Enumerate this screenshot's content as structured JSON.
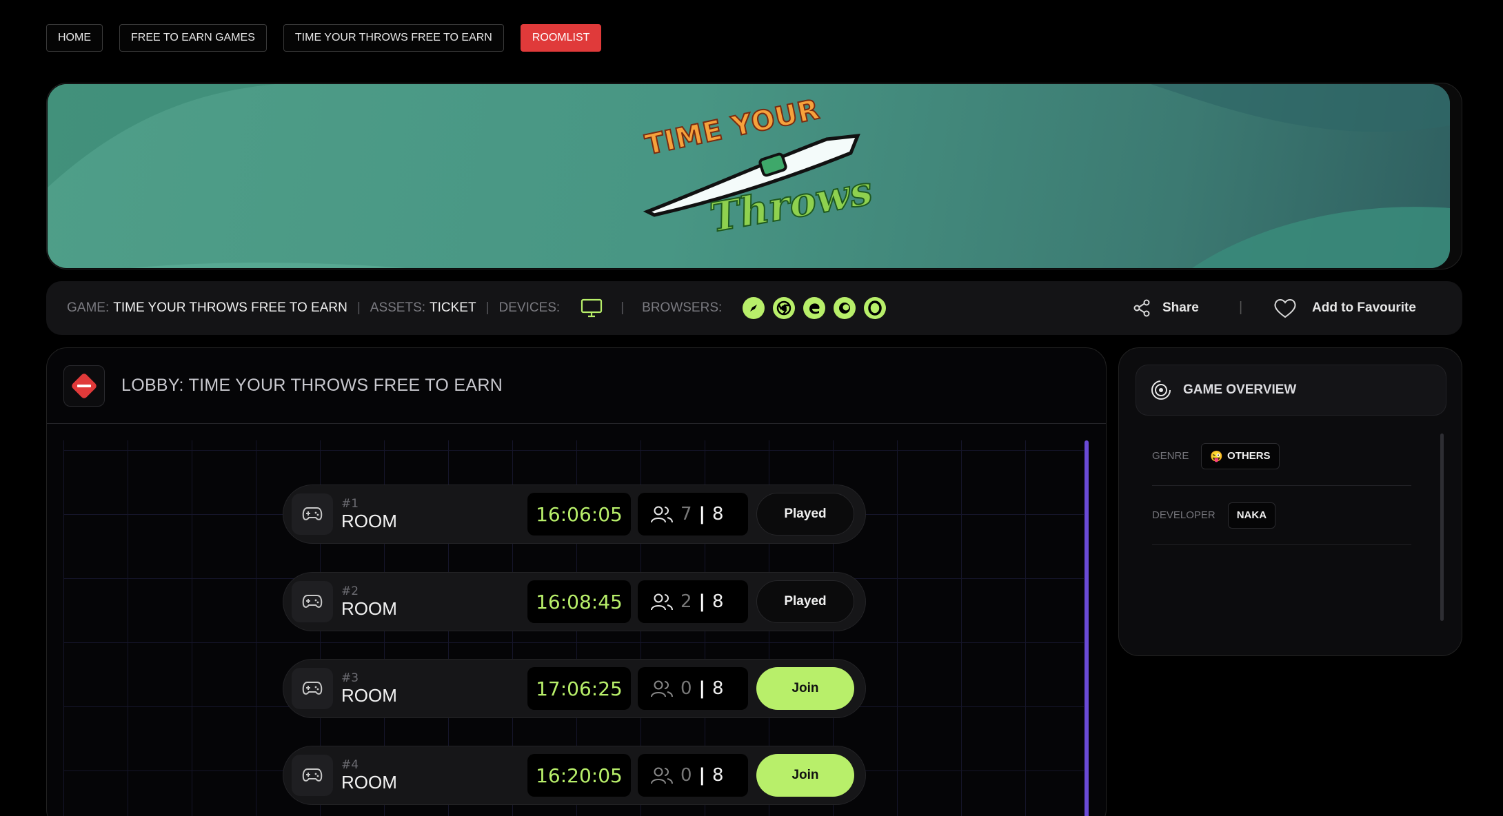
{
  "breadcrumbs": [
    {
      "label": "HOME",
      "active": false
    },
    {
      "label": "FREE TO EARN GAMES",
      "active": false
    },
    {
      "label": "TIME YOUR THROWS FREE TO EARN",
      "active": false
    },
    {
      "label": "ROOMLIST",
      "active": true
    }
  ],
  "banner": {
    "logo_line1": "TIME YOUR",
    "logo_line2": "Throws"
  },
  "infobar": {
    "game_label": "GAME:",
    "game_value": "TIME YOUR THROWS FREE TO EARN",
    "assets_label": "ASSETS:",
    "assets_value": "TICKET",
    "devices_label": "DEVICES:",
    "browsers_label": "BROWSERS:",
    "browser_icons": [
      "safari-icon",
      "chrome-icon",
      "edge-icon",
      "firefox-icon",
      "opera-icon"
    ],
    "share_label": "Share",
    "favourite_label": "Add to Favourite"
  },
  "lobby": {
    "title": "LOBBY: TIME YOUR THROWS FREE TO EARN",
    "rooms": [
      {
        "number": "#1",
        "name": "ROOM",
        "time": "16:06:05",
        "players": "7",
        "max": "8",
        "action": "Played"
      },
      {
        "number": "#2",
        "name": "ROOM",
        "time": "16:08:45",
        "players": "2",
        "max": "8",
        "action": "Played"
      },
      {
        "number": "#3",
        "name": "ROOM",
        "time": "17:06:25",
        "players": "0",
        "max": "8",
        "action": "Join"
      },
      {
        "number": "#4",
        "name": "ROOM",
        "time": "16:20:05",
        "players": "0",
        "max": "8",
        "action": "Join"
      }
    ]
  },
  "overview": {
    "title": "GAME OVERVIEW",
    "genre_label": "GENRE",
    "genre_emoji": "😜",
    "genre_value": "OTHERS",
    "developer_label": "DEVELOPER",
    "developer_value": "NAKA"
  },
  "colors": {
    "accent_green": "#b8ef6a",
    "accent_red": "#e03a3a",
    "scroll_purple": "#6a4ad6"
  }
}
